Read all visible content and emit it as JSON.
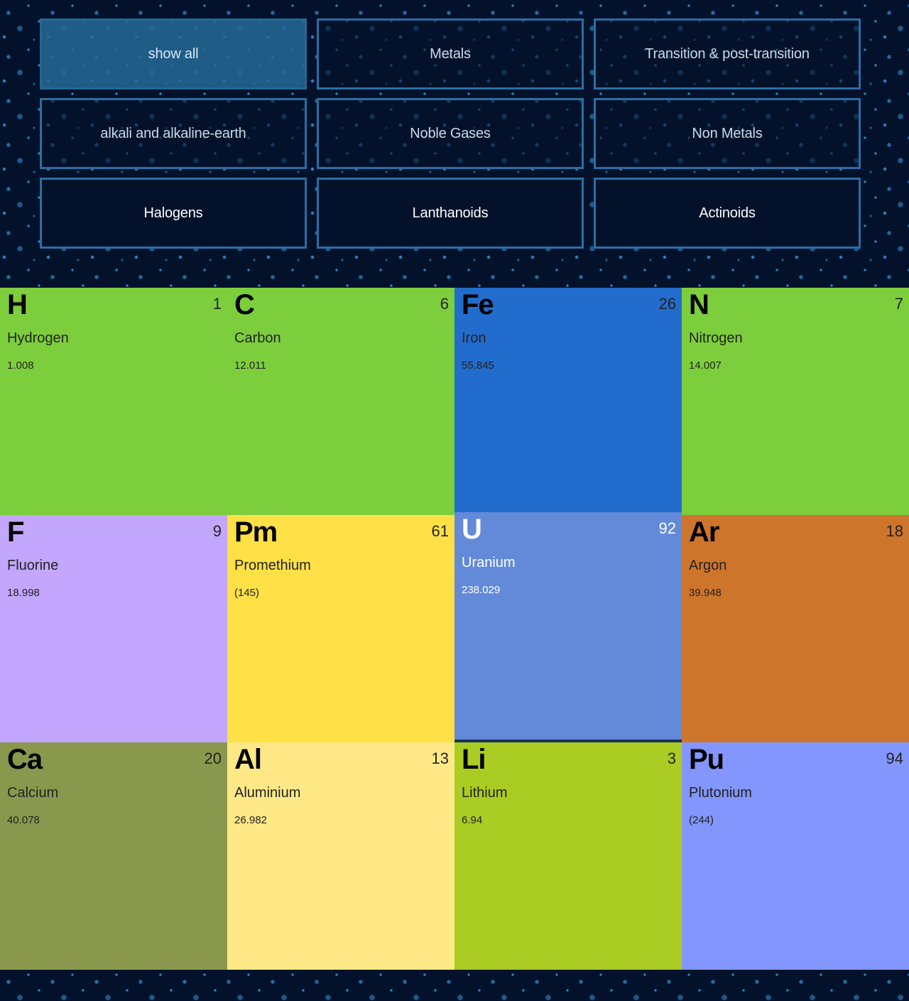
{
  "filters": [
    {
      "label": "show all",
      "state": "active"
    },
    {
      "label": "Metals",
      "state": "normal"
    },
    {
      "label": "Transition & post-transition",
      "state": "normal"
    },
    {
      "label": "alkali and alkaline-earth",
      "state": "normal"
    },
    {
      "label": "Noble Gases",
      "state": "normal"
    },
    {
      "label": "Non Metals",
      "state": "normal"
    },
    {
      "label": "Halogens",
      "state": "solid"
    },
    {
      "label": "Lanthanoids",
      "state": "solid"
    },
    {
      "label": "Actinoids",
      "state": "solid"
    }
  ],
  "elements": [
    {
      "symbol": "H",
      "number": "1",
      "name": "Hydrogen",
      "mass": "1.008",
      "color": "#7dce3d",
      "text_color": "dark"
    },
    {
      "symbol": "C",
      "number": "6",
      "name": "Carbon",
      "mass": "12.011",
      "color": "#7dce3d",
      "text_color": "dark"
    },
    {
      "symbol": "Fe",
      "number": "26",
      "name": "Iron",
      "mass": "55.845",
      "color": "#226ccd",
      "text_color": "dark"
    },
    {
      "symbol": "N",
      "number": "7",
      "name": "Nitrogen",
      "mass": "14.007",
      "color": "#7dce3d",
      "text_color": "dark"
    },
    {
      "symbol": "F",
      "number": "9",
      "name": "Fluorine",
      "mass": "18.998",
      "color": "#c3a6fd",
      "text_color": "dark"
    },
    {
      "symbol": "Pm",
      "number": "61",
      "name": "Promethium",
      "mass": "(145)",
      "color": "#ffe046",
      "text_color": "dark"
    },
    {
      "symbol": "U",
      "number": "92",
      "name": "Uranium",
      "mass": "238.029",
      "color": "#628ad9",
      "text_color": "light",
      "highlight": true
    },
    {
      "symbol": "Ar",
      "number": "18",
      "name": "Argon",
      "mass": "39.948",
      "color": "#ce752c",
      "text_color": "dark"
    },
    {
      "symbol": "Ca",
      "number": "20",
      "name": "Calcium",
      "mass": "40.078",
      "color": "#8a984d",
      "text_color": "dark"
    },
    {
      "symbol": "Al",
      "number": "13",
      "name": "Aluminium",
      "mass": "26.982",
      "color": "#ffe987",
      "text_color": "dark"
    },
    {
      "symbol": "Li",
      "number": "3",
      "name": "Lithium",
      "mass": "6.94",
      "color": "#abcc22",
      "text_color": "dark"
    },
    {
      "symbol": "Pu",
      "number": "94",
      "name": "Plutonium",
      "mass": "(244)",
      "color": "#8296fd",
      "text_color": "dark"
    }
  ]
}
